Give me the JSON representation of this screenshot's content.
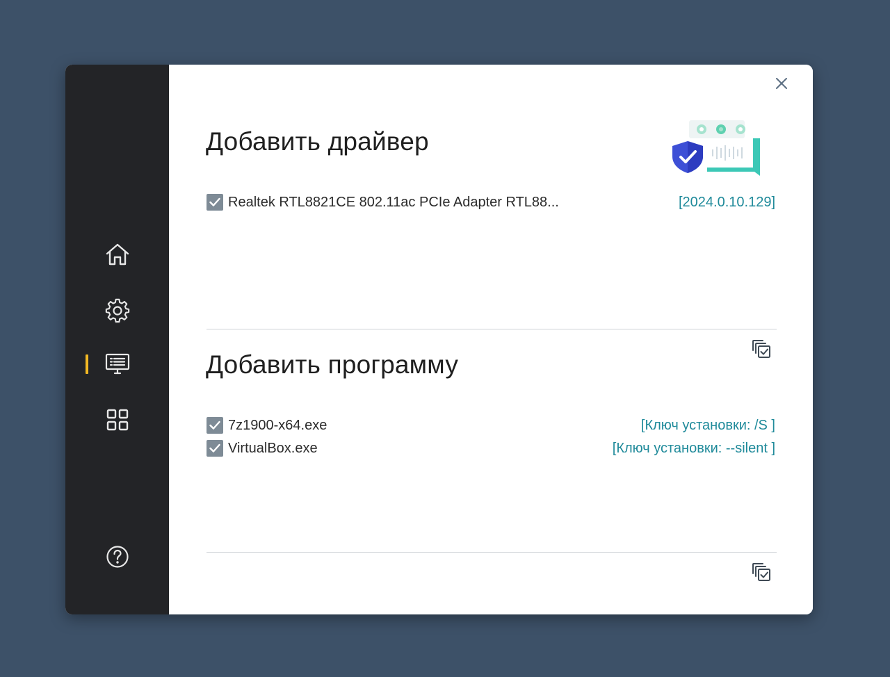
{
  "sidebar": {
    "items": [
      {
        "icon": "home-icon"
      },
      {
        "icon": "gear-icon"
      },
      {
        "icon": "monitor-list-icon",
        "active": true
      },
      {
        "icon": "grid-icon"
      }
    ],
    "help_icon": "help-icon",
    "accent": "#f2b824"
  },
  "driver_section": {
    "title": "Добавить драйвер",
    "items": [
      {
        "name": "Realtek RTL8821CE 802.11ac PCIe Adapter RTL88...",
        "version": "[2024.0.10.129]",
        "checked": true
      }
    ]
  },
  "program_section": {
    "title": "Добавить программу",
    "items": [
      {
        "name": "7z1900-x64.exe",
        "install_key": "[Ключ установки: /S ]",
        "checked": true
      },
      {
        "name": "VirtualBox.exe",
        "install_key": "[Ключ установки: --silent ]",
        "checked": true
      }
    ]
  },
  "colors": {
    "background": "#3d5168",
    "sidebar": "#232427",
    "link": "#1f8a9a",
    "checkbox": "#7e8b96"
  }
}
